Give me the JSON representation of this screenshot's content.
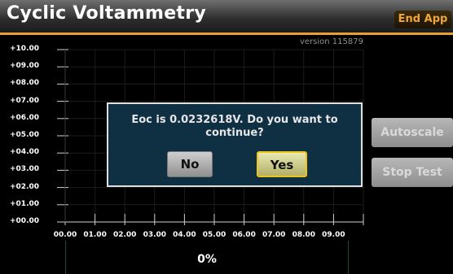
{
  "app": {
    "title": "Cyclic Voltammetry",
    "end_app_label": "End App",
    "version": "version 115879"
  },
  "plot": {
    "y_ticks": [
      "+10.00",
      "+09.00",
      "+08.00",
      "+07.00",
      "+06.00",
      "+05.00",
      "+04.00",
      "+03.00",
      "+02.00",
      "+01.00",
      "+00.00"
    ],
    "x_ticks": [
      "00.00",
      "01.00",
      "02.00",
      "03.00",
      "04.00",
      "05.00",
      "06.00",
      "07.00",
      "08.00",
      "09.00"
    ]
  },
  "side_buttons": {
    "autoscale_label": "Autoscale",
    "stop_test_label": "Stop Test"
  },
  "status": {
    "progress_text": "0%",
    "progress_value": 0
  },
  "dialog": {
    "message_line1": "Eoc is 0.0232618V. Do you want to",
    "message_line2": "continue?",
    "no_label": "No",
    "yes_label": "Yes"
  },
  "colors": {
    "accent": "#e8a12d",
    "dialog_bg": "#0f2f43",
    "yes_border": "#f0c419"
  }
}
